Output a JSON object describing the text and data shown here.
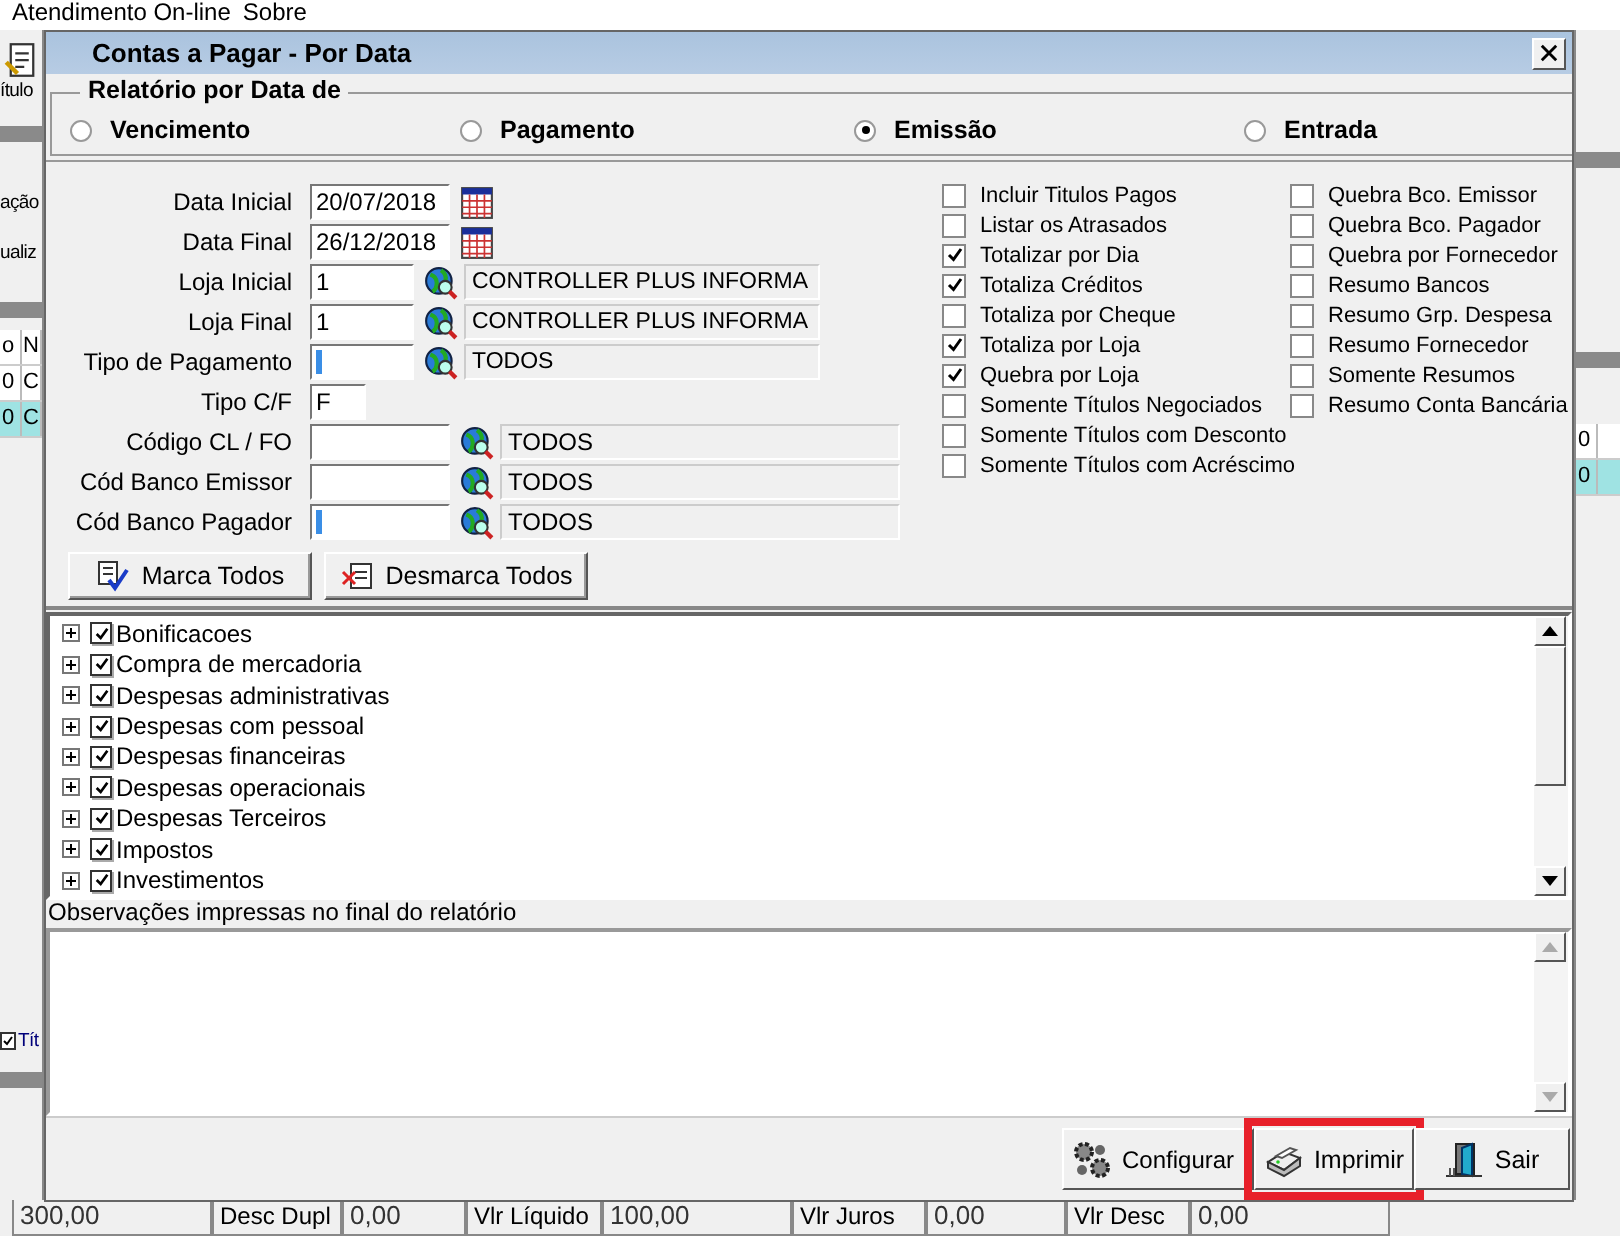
{
  "menu": [
    {
      "label": "Atendimento On-line"
    },
    {
      "label": "Sobre"
    }
  ],
  "background_window": {
    "toolbar_label": "ítulo",
    "row_labels": [
      "ação",
      "ualiz"
    ],
    "grid_headers": [
      "o",
      "N"
    ],
    "grid_rows": [
      {
        "cells": [
          "0",
          "C"
        ],
        "selected": false
      },
      {
        "cells": [
          "0",
          "C"
        ],
        "selected": true
      }
    ],
    "right_cells": [
      "0",
      "0"
    ],
    "tab": {
      "label": "Tít",
      "checked": true
    }
  },
  "dialog": {
    "title": "Contas a Pagar - Por Data",
    "date_group": {
      "title": "Relatório por Data de",
      "options": [
        {
          "label": "Vencimento",
          "selected": false
        },
        {
          "label": "Pagamento",
          "selected": false
        },
        {
          "label": "Emissão",
          "selected": true
        },
        {
          "label": "Entrada",
          "selected": false
        }
      ]
    },
    "fields": [
      {
        "kind": "date",
        "label": "Data Inicial",
        "value": "20/07/2018"
      },
      {
        "kind": "date",
        "label": "Data Final",
        "value": "26/12/2018"
      },
      {
        "kind": "lookup",
        "label": "Loja Inicial",
        "value": "1",
        "description": "CONTROLLER PLUS INFORMA"
      },
      {
        "kind": "lookup",
        "label": "Loja Final",
        "value": "1",
        "description": "CONTROLLER PLUS INFORMA"
      },
      {
        "kind": "lookup",
        "label": "Tipo de Pagamento",
        "cursor": true,
        "description": "TODOS"
      },
      {
        "kind": "short",
        "label": "Tipo C/F",
        "value": "F"
      },
      {
        "kind": "lookup_wide",
        "label": "Código CL / FO",
        "description": "TODOS"
      },
      {
        "kind": "lookup_wide",
        "label": "Cód Banco Emissor",
        "description": "TODOS"
      },
      {
        "kind": "lookup_wide",
        "label": "Cód Banco Pagador",
        "cursor": true,
        "description": "TODOS"
      }
    ],
    "options_left": [
      {
        "label": "Incluir Titulos Pagos",
        "checked": false
      },
      {
        "label": "Listar os Atrasados",
        "checked": false
      },
      {
        "label": "Totalizar por Dia",
        "checked": true
      },
      {
        "label": "Totaliza Créditos",
        "checked": true
      },
      {
        "label": "Totaliza por Cheque",
        "checked": false
      },
      {
        "label": "Totaliza por Loja",
        "checked": true
      },
      {
        "label": "Quebra por Loja",
        "checked": true
      },
      {
        "label": "Somente Títulos Negociados",
        "checked": false
      },
      {
        "label": "Somente Títulos com Desconto",
        "checked": false
      },
      {
        "label": "Somente Títulos com Acréscimo",
        "checked": false
      }
    ],
    "options_right": [
      {
        "label": "Quebra Bco. Emissor",
        "checked": false
      },
      {
        "label": "Quebra Bco. Pagador",
        "checked": false
      },
      {
        "label": "Quebra por Fornecedor",
        "checked": false
      },
      {
        "label": "Resumo Bancos",
        "checked": false
      },
      {
        "label": "Resumo Grp. Despesa",
        "checked": false
      },
      {
        "label": "Resumo Fornecedor",
        "checked": false
      },
      {
        "label": "Somente Resumos",
        "checked": false
      },
      {
        "label": "Resumo Conta Bancária",
        "checked": false
      }
    ],
    "select_buttons": [
      {
        "kind": "mark",
        "label": "Marca Todos"
      },
      {
        "kind": "unmark",
        "label": "Desmarca Todos"
      }
    ],
    "expense_groups": [
      {
        "label": "Bonificacoes",
        "checked": true,
        "expanded": false
      },
      {
        "label": "Compra de mercadoria",
        "checked": true,
        "expanded": false
      },
      {
        "label": "Despesas administrativas",
        "checked": true,
        "expanded": false
      },
      {
        "label": "Despesas com pessoal",
        "checked": true,
        "expanded": false
      },
      {
        "label": "Despesas financeiras",
        "checked": true,
        "expanded": false
      },
      {
        "label": "Despesas operacionais",
        "checked": true,
        "expanded": false
      },
      {
        "label": "Despesas Terceiros",
        "checked": true,
        "expanded": false
      },
      {
        "label": "Impostos",
        "checked": true,
        "expanded": false
      },
      {
        "label": "Investimentos",
        "checked": true,
        "expanded": false
      }
    ],
    "notes": {
      "label": "Observações impressas no final do relatório"
    },
    "actions": [
      {
        "kind": "configure",
        "label": "Configurar",
        "highlighted": false
      },
      {
        "kind": "print",
        "label": "Imprimir",
        "highlighted": true
      },
      {
        "kind": "exit",
        "label": "Sair",
        "highlighted": false
      }
    ]
  },
  "status_bar": [
    {
      "kind": "value",
      "text": "300,00"
    },
    {
      "kind": "label",
      "text": "Desc Dupl"
    },
    {
      "kind": "value",
      "text": "0,00"
    },
    {
      "kind": "label",
      "text": "Vlr Líquido"
    },
    {
      "kind": "value",
      "text": "100,00"
    },
    {
      "kind": "label",
      "text": "Vlr Juros"
    },
    {
      "kind": "value",
      "text": "0,00"
    },
    {
      "kind": "label",
      "text": "Vlr Desc"
    },
    {
      "kind": "value",
      "text": "0,00"
    }
  ]
}
